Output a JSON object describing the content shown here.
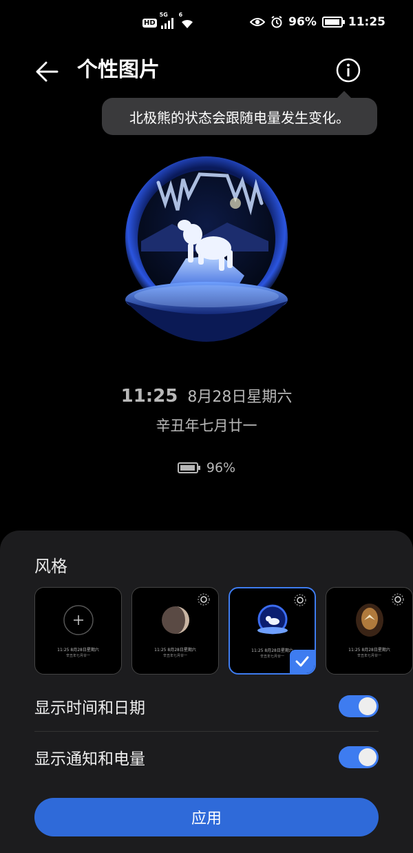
{
  "status_bar": {
    "hd": "HD",
    "signal_tag": "5G",
    "wifi_tag": "6",
    "battery": "96%",
    "time": "11:25"
  },
  "app_bar": {
    "title": "个性图片"
  },
  "tooltip": "北极熊的状态会跟随电量发生变化。",
  "preview": {
    "time": "11:25",
    "date": "8月28日星期六",
    "lunar": "辛丑年七月廿一",
    "battery": "96%",
    "battery_level": 0.96
  },
  "sheet": {
    "title": "风格",
    "styles": [
      {
        "mini_time": "11:25  8月28日星期六",
        "mini_lunar": "辛丑年七月廿一"
      },
      {
        "mini_time": "11:25  8月28日星期六",
        "mini_lunar": "辛丑年七月廿一"
      },
      {
        "mini_time": "11:25  8月28日星期六",
        "mini_lunar": "辛丑年七月廿一"
      },
      {
        "mini_time": "11:25  8月28日星期六",
        "mini_lunar": "辛丑年七月廿一"
      }
    ],
    "selected_style_index": 2,
    "settings": [
      {
        "label": "显示时间和日期",
        "enabled": true
      },
      {
        "label": "显示通知和电量",
        "enabled": true
      }
    ],
    "apply_label": "应用"
  },
  "colors": {
    "accent": "#3e7cf0",
    "button": "#2f6ad9",
    "sheet_bg": "#1c1c1e",
    "tooltip_bg": "#3a3a3c"
  }
}
